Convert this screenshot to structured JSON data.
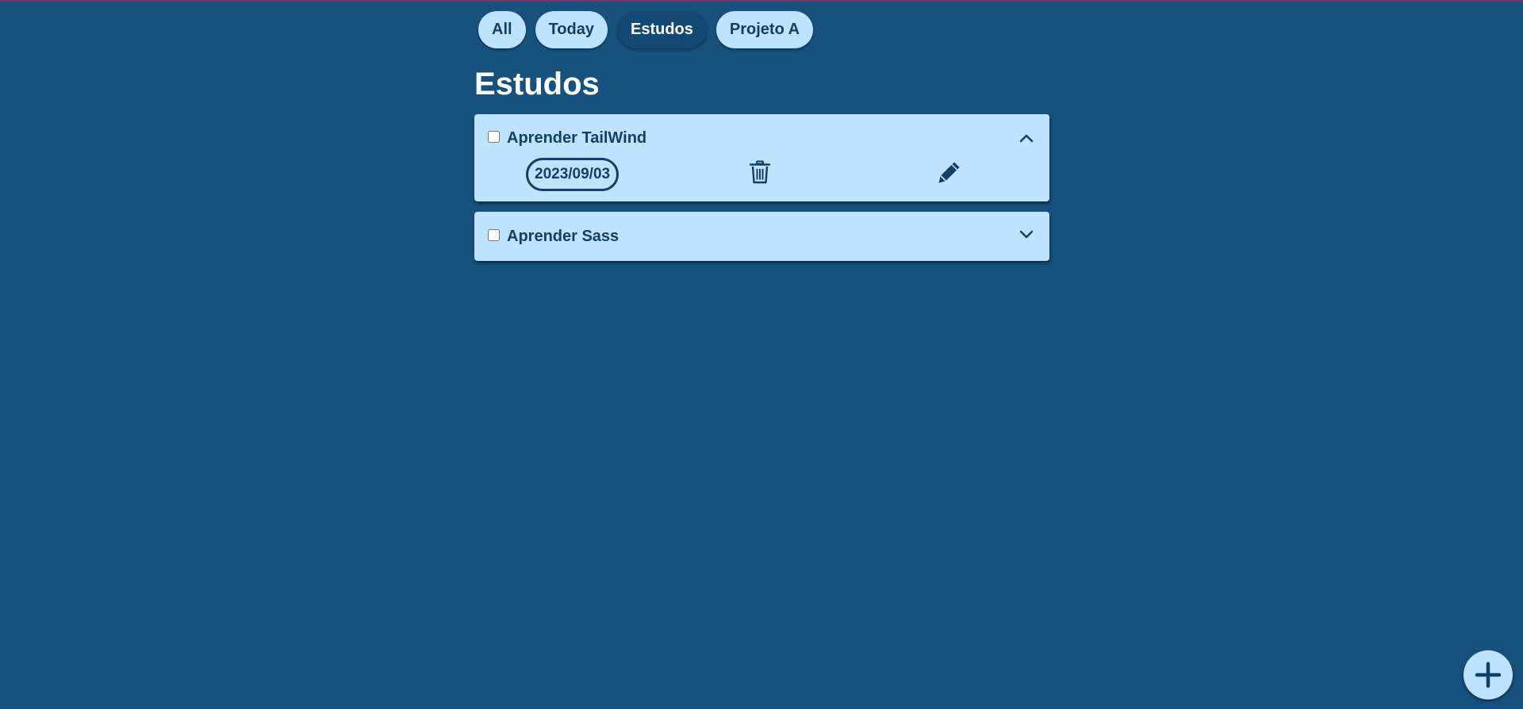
{
  "tabs": [
    {
      "label": "All"
    },
    {
      "label": "Today"
    },
    {
      "label": "Estudos",
      "active": true
    },
    {
      "label": "Projeto A"
    }
  ],
  "page": {
    "title": "Estudos"
  },
  "tasks": [
    {
      "title": "Aprender TailWind",
      "expanded": true,
      "checked": false,
      "date": "2023/09/03"
    },
    {
      "title": "Aprender Sass",
      "expanded": false,
      "checked": false
    }
  ],
  "icons": {
    "collapse": "chevron-up-icon",
    "expand": "chevron-down-icon",
    "delete": "trash-icon",
    "edit": "pencil-icon",
    "add": "plus-icon"
  },
  "colors": {
    "background": "#17527e",
    "card": "#bde3fe",
    "text_dark": "#123f66",
    "tab_active": "#124a74",
    "title": "#ffffff"
  }
}
